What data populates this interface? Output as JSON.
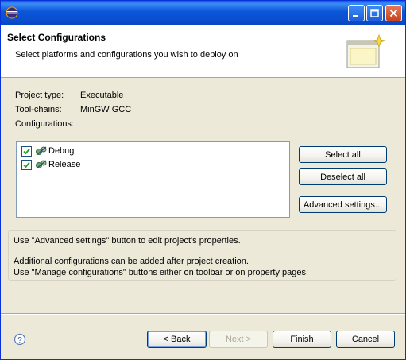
{
  "header": {
    "title": "Select Configurations",
    "description": "Select platforms and configurations you wish to deploy on"
  },
  "properties": {
    "project_type_label": "Project type:",
    "project_type_value": "Executable",
    "toolchains_label": "Tool-chains:",
    "toolchains_value": "MinGW GCC",
    "configurations_label": "Configurations:"
  },
  "configurations": [
    {
      "label": "Debug",
      "checked": true
    },
    {
      "label": "Release",
      "checked": true
    }
  ],
  "side_buttons": {
    "select_all": "Select all",
    "deselect_all": "Deselect all",
    "advanced": "Advanced settings..."
  },
  "info": {
    "line1": "Use \"Advanced settings\" button to edit project's properties.",
    "line2": "Additional configurations can be added after project creation.",
    "line3": "Use \"Manage configurations\" buttons either on toolbar or on property pages."
  },
  "footer": {
    "back": "< Back",
    "next": "Next >",
    "finish": "Finish",
    "cancel": "Cancel"
  },
  "icons": {
    "app": "eclipse-icon",
    "banner": "wizard-banner-icon",
    "help": "help-icon"
  }
}
